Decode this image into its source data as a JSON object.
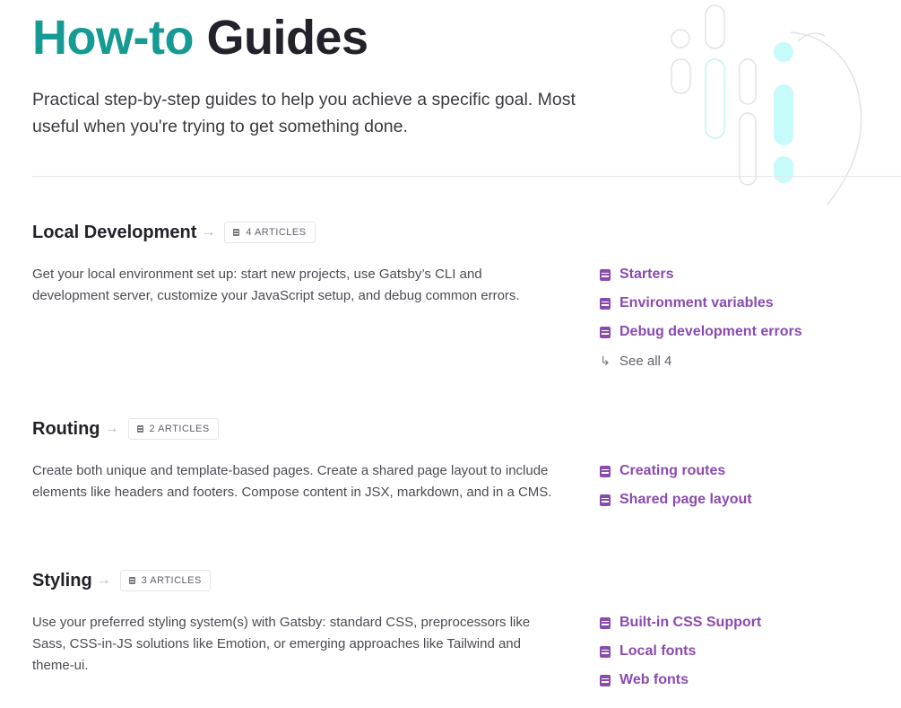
{
  "header": {
    "title_accent": "How-to",
    "title_rest": "Guides",
    "description": "Practical step-by-step guides to help you achieve a specific goal. Most useful when you're trying to get something done."
  },
  "colors": {
    "accent_teal": "#159a94",
    "link_purple": "#8a4baf",
    "text_dark": "#232129"
  },
  "sections": [
    {
      "title": "Local Development",
      "arrow": "→",
      "badge": "4 ARTICLES",
      "description": "Get your local environment set up: start new projects, use Gatsby’s CLI and development server, customize your JavaScript setup, and debug common errors.",
      "links": [
        "Starters",
        "Environment variables",
        "Debug development errors"
      ],
      "see_all_arrow": "↳",
      "see_all": "See all 4"
    },
    {
      "title": "Routing",
      "arrow": "→",
      "badge": "2 ARTICLES",
      "description": "Create both unique and template-based pages. Create a shared page layout to include elements like headers and footers. Compose content in JSX, markdown, and in a CMS.",
      "links": [
        "Creating routes",
        "Shared page layout"
      ]
    },
    {
      "title": "Styling",
      "arrow": "→",
      "badge": "3 ARTICLES",
      "description": "Use your preferred styling system(s) with Gatsby: standard CSS, preprocessors like Sass, CSS-in-JS solutions like Emotion, or emerging approaches like Tailwind and theme-ui.",
      "links": [
        "Built-in CSS Support",
        "Local fonts",
        "Web fonts"
      ]
    }
  ]
}
